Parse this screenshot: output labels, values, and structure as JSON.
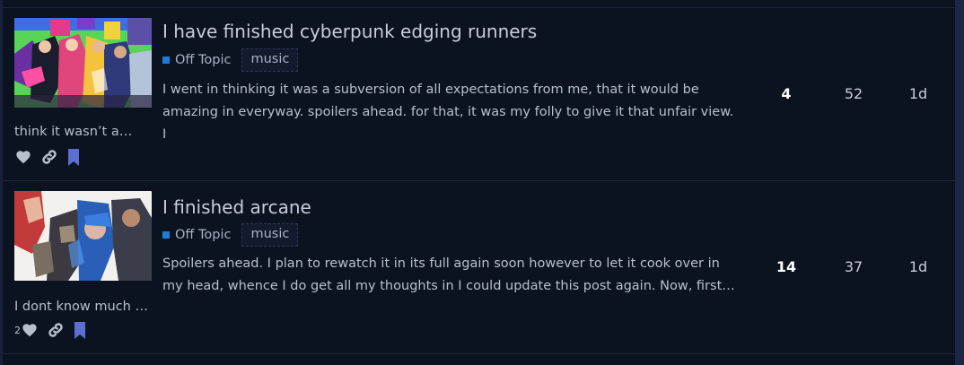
{
  "topics": [
    {
      "title": "I have finished cyberpunk edging runners",
      "category": "Off Topic",
      "tag": "music",
      "excerpt": "I went in thinking it was a subversion of all expectations from me, that it would be amazing in everyway. spoilers ahead. for that, it was my folly to give it that unfair view. I",
      "excerpt_tail": "think it wasn’t a…",
      "like_count": "",
      "replies": "4",
      "views": "52",
      "activity": "1d",
      "thumbnail": "cyberpunk-edgerunners-artwork"
    },
    {
      "title": "I finished arcane",
      "category": "Off Topic",
      "tag": "music",
      "excerpt": "Spoilers ahead. I plan to rewatch it in its full again soon however to let it cook over in my head, whence I do get all my thoughts in I could update this post again. Now, first…",
      "excerpt_tail": "I dont know much …",
      "like_count": "2",
      "replies": "14",
      "views": "37",
      "activity": "1d",
      "thumbnail": "arcane-artwork"
    }
  ],
  "icons": {
    "like": "heart-icon",
    "share": "link-icon",
    "bookmark": "bookmark-icon"
  },
  "colors": {
    "background": "#0b1220",
    "category": "#1f7dd6",
    "bookmark": "#5b6fd0",
    "icon": "#b9c0cd"
  }
}
